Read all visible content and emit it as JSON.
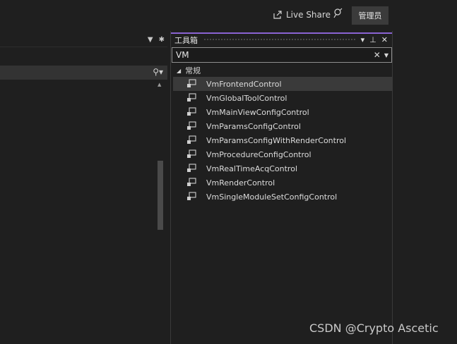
{
  "titlebar": {
    "live_share_label": "Live Share",
    "admin_label": "管理员"
  },
  "toolbox": {
    "title": "工具箱",
    "search_value": "VM",
    "group_label": "常规",
    "items": [
      {
        "label": "VmFrontendControl"
      },
      {
        "label": "VmGlobalToolControl"
      },
      {
        "label": "VmMainViewConfigControl"
      },
      {
        "label": "VmParamsConfigControl"
      },
      {
        "label": "VmParamsConfigWithRenderControl"
      },
      {
        "label": "VmProcedureConfigControl"
      },
      {
        "label": "VmRealTimeAcqControl"
      },
      {
        "label": "VmRenderControl"
      },
      {
        "label": "VmSingleModuleSetConfigControl"
      }
    ],
    "selected_index": 0
  },
  "watermark": "CSDN @Crypto Ascetic",
  "colors": {
    "background": "#1f1f1f",
    "accent": "#8a63d2",
    "selected_row": "#3a3a3a"
  }
}
